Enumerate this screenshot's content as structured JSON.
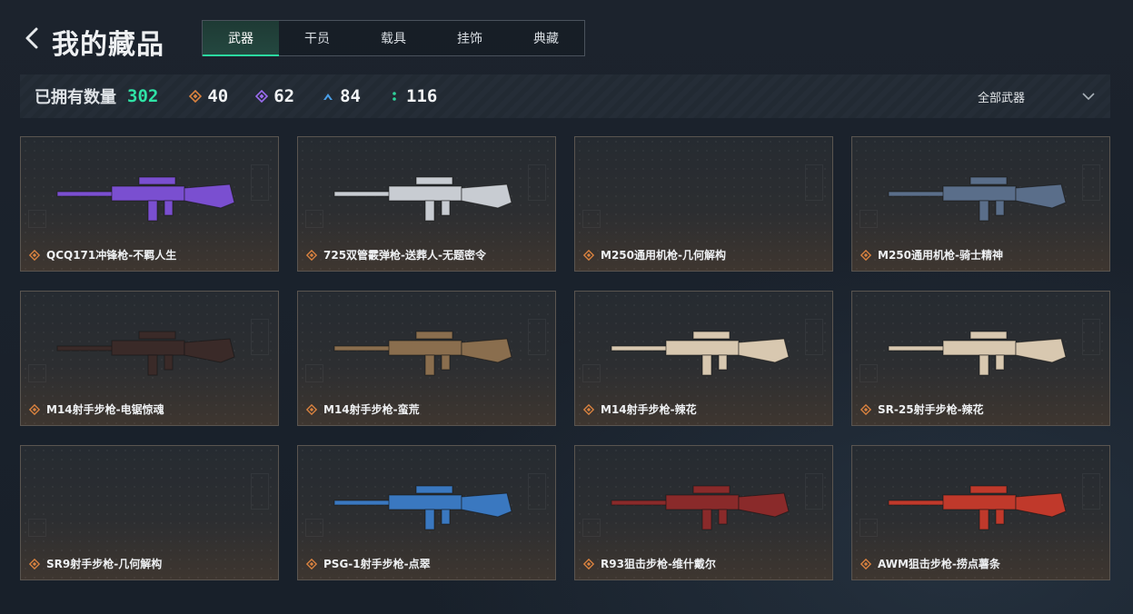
{
  "header": {
    "title": "我的藏品"
  },
  "tabs": [
    {
      "label": "武器",
      "active": true
    },
    {
      "label": "干员",
      "active": false
    },
    {
      "label": "载具",
      "active": false
    },
    {
      "label": "挂饰",
      "active": false
    },
    {
      "label": "典藏",
      "active": false
    }
  ],
  "stats": {
    "owned_label": "已拥有数量",
    "owned_count": "302",
    "rarities": [
      {
        "icon": "orange-diamond-icon",
        "color": "#d9823f",
        "count": "40"
      },
      {
        "icon": "purple-diamond-icon",
        "color": "#9b6cf0",
        "count": "62"
      },
      {
        "icon": "blue-chevron-icon",
        "color": "#4a9fe8",
        "count": "84"
      },
      {
        "icon": "green-dots-icon",
        "color": "#2fd39a",
        "count": "116"
      }
    ]
  },
  "filter": {
    "label": "全部武器"
  },
  "items": [
    {
      "name": "QCQ171冲锋枪-不羁人生",
      "rarity_color": "#d9823f",
      "skin_color": "#7a4fd0"
    },
    {
      "name": "725双管霰弹枪-送葬人-无题密令",
      "rarity_color": "#d9823f",
      "skin_color": "#c8ccd2"
    },
    {
      "name": "M250通用机枪-几何解构",
      "rarity_color": "#d9823f",
      "skin_color": ""
    },
    {
      "name": "M250通用机枪-骑士精神",
      "rarity_color": "#d9823f",
      "skin_color": "#5a6e8a"
    },
    {
      "name": "M14射手步枪-电锯惊魂",
      "rarity_color": "#d9823f",
      "skin_color": "#3a2a28"
    },
    {
      "name": "M14射手步枪-蛮荒",
      "rarity_color": "#d9823f",
      "skin_color": "#8a6e4e"
    },
    {
      "name": "M14射手步枪-辣花",
      "rarity_color": "#d9823f",
      "skin_color": "#d8c8b0"
    },
    {
      "name": "SR-25射手步枪-辣花",
      "rarity_color": "#d9823f",
      "skin_color": "#d8c8b0"
    },
    {
      "name": "SR9射手步枪-几何解构",
      "rarity_color": "#d9823f",
      "skin_color": ""
    },
    {
      "name": "PSG-1射手步枪-点翠",
      "rarity_color": "#d9823f",
      "skin_color": "#3a78c0"
    },
    {
      "name": "R93狙击步枪-维什戴尔",
      "rarity_color": "#d9823f",
      "skin_color": "#8a2a2a"
    },
    {
      "name": "AWM狙击步枪-捞点薯条",
      "rarity_color": "#d9823f",
      "skin_color": "#c0392b"
    }
  ]
}
